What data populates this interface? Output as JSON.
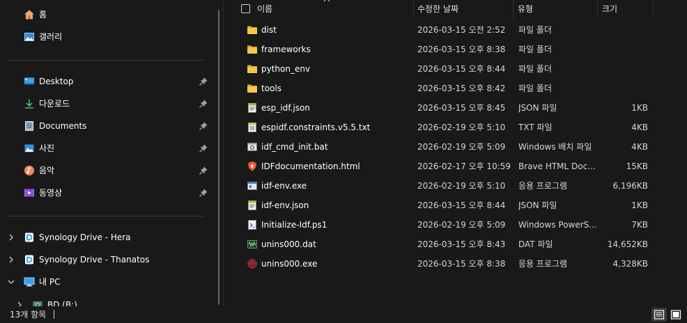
{
  "sidebar": {
    "top_items": [
      {
        "label": "홈",
        "icon": "home-icon"
      },
      {
        "label": "갤러리",
        "icon": "gallery-icon"
      }
    ],
    "quick_access": [
      {
        "label": "Desktop",
        "icon": "desktop-icon",
        "pinned": true
      },
      {
        "label": "다운로드",
        "icon": "download-icon",
        "pinned": true
      },
      {
        "label": "Documents",
        "icon": "documents-icon",
        "pinned": true
      },
      {
        "label": "사진",
        "icon": "pictures-icon",
        "pinned": true
      },
      {
        "label": "음악",
        "icon": "music-icon",
        "pinned": true
      },
      {
        "label": "동영상",
        "icon": "videos-icon",
        "pinned": true
      }
    ],
    "drives": [
      {
        "label": "Synology Drive - Hera",
        "icon": "synology-drive-icon",
        "expanded": false
      },
      {
        "label": "Synology Drive - Thanatos",
        "icon": "synology-drive-icon",
        "expanded": false
      },
      {
        "label": "내 PC",
        "icon": "this-pc-icon",
        "expanded": true
      },
      {
        "label": "BD (B:)",
        "icon": "drive-icon",
        "expanded": false
      }
    ]
  },
  "columns": {
    "name": "이름",
    "date": "수정한 날짜",
    "type": "유형",
    "size": "크기"
  },
  "files": [
    {
      "name": "dist",
      "date": "2026-03-15 오전 2:52",
      "type": "파일 폴더",
      "size": "",
      "icon": "folder-icon"
    },
    {
      "name": "frameworks",
      "date": "2026-03-15 오후 8:38",
      "type": "파일 폴더",
      "size": "",
      "icon": "folder-icon"
    },
    {
      "name": "python_env",
      "date": "2026-03-15 오후 8:44",
      "type": "파일 폴더",
      "size": "",
      "icon": "folder-icon"
    },
    {
      "name": "tools",
      "date": "2026-03-15 오후 8:42",
      "type": "파일 폴더",
      "size": "",
      "icon": "folder-icon"
    },
    {
      "name": "esp_idf.json",
      "date": "2026-03-15 오후 8:45",
      "type": "JSON 파일",
      "size": "1KB",
      "icon": "json-file-icon"
    },
    {
      "name": "espidf.constraints.v5.5.txt",
      "date": "2026-02-19 오후 5:10",
      "type": "TXT 파일",
      "size": "4KB",
      "icon": "txt-file-icon"
    },
    {
      "name": "idf_cmd_init.bat",
      "date": "2026-02-19 오후 5:09",
      "type": "Windows 배치 파일",
      "size": "4KB",
      "icon": "bat-file-icon"
    },
    {
      "name": "IDFdocumentation.html",
      "date": "2026-02-17 오후 10:59",
      "type": "Brave HTML Doc...",
      "size": "15KB",
      "icon": "brave-html-icon"
    },
    {
      "name": "idf-env.exe",
      "date": "2026-02-19 오후 5:10",
      "type": "응용 프로그램",
      "size": "6,196KB",
      "icon": "exe-file-icon"
    },
    {
      "name": "idf-env.json",
      "date": "2026-03-15 오후 8:44",
      "type": "JSON 파일",
      "size": "1KB",
      "icon": "json-file-icon"
    },
    {
      "name": "Initialize-Idf.ps1",
      "date": "2026-02-19 오후 5:09",
      "type": "Windows PowerS...",
      "size": "7KB",
      "icon": "ps1-file-icon"
    },
    {
      "name": "unins000.dat",
      "date": "2026-03-15 오후 8:43",
      "type": "DAT 파일",
      "size": "14,652KB",
      "icon": "dat-file-icon"
    },
    {
      "name": "unins000.exe",
      "date": "2026-03-15 오후 8:38",
      "type": "응용 프로그램",
      "size": "4,328KB",
      "icon": "uninstaller-icon"
    }
  ],
  "status": {
    "item_count": "13개 항목"
  },
  "colors": {
    "background": "#191919",
    "folder": "#f4c64b",
    "accent": "#4aa3f0"
  }
}
